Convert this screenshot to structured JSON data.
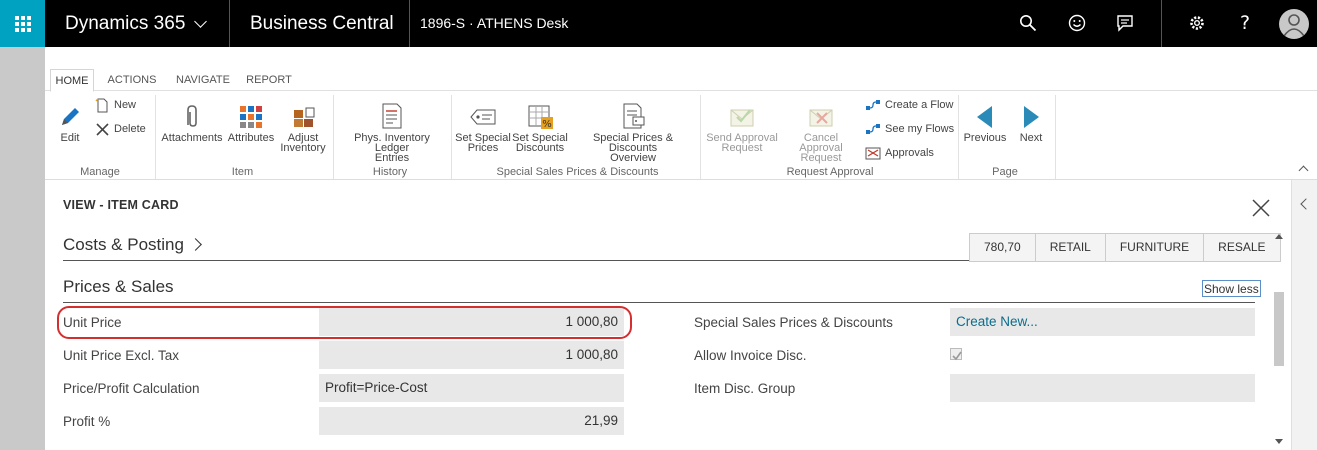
{
  "topbar": {
    "app_name": "Dynamics 365",
    "product": "Business Central",
    "company": "1896-S · ATHENS Desk"
  },
  "ribbon": {
    "tabs": [
      "HOME",
      "ACTIONS",
      "NAVIGATE",
      "REPORT"
    ],
    "manage": {
      "edit": "Edit",
      "new": "New",
      "delete": "Delete",
      "group": "Manage"
    },
    "item": {
      "attachments": "Attachments",
      "attributes": "Attributes",
      "adjust_line1": "Adjust",
      "adjust_line2": "Inventory",
      "group": "Item"
    },
    "history": {
      "line1": "Phys. Inventory Ledger",
      "line2": "Entries",
      "group": "History"
    },
    "special": {
      "set_prices_1": "Set Special",
      "set_prices_2": "Prices",
      "set_discounts_1": "Set Special",
      "set_discounts_2": "Discounts",
      "overview_1": "Special Prices & Discounts",
      "overview_2": "Overview",
      "group": "Special Sales Prices & Discounts"
    },
    "approval": {
      "send_1": "Send Approval",
      "send_2": "Request",
      "cancel_1": "Cancel Approval",
      "cancel_2": "Request",
      "create_flow": "Create a Flow",
      "see_flows": "See my Flows",
      "approvals": "Approvals",
      "group": "Request Approval"
    },
    "page": {
      "previous": "Previous",
      "next": "Next",
      "group": "Page"
    }
  },
  "card": {
    "view_title": "VIEW - ITEM CARD",
    "costs_section": "Costs & Posting",
    "facts": [
      "780,70",
      "RETAIL",
      "FURNITURE",
      "RESALE"
    ],
    "prices_section": "Prices & Sales",
    "show_less": "Show less",
    "fields_left": [
      {
        "label": "Unit Price",
        "value": "1 000,80"
      },
      {
        "label": "Unit Price Excl. Tax",
        "value": "1 000,80"
      },
      {
        "label": "Price/Profit Calculation",
        "value": "Profit=Price-Cost"
      },
      {
        "label": "Profit %",
        "value": "21,99"
      }
    ],
    "fields_right": [
      {
        "label": "Special Sales Prices & Discounts",
        "value": "Create New..."
      },
      {
        "label": "Allow Invoice Disc.",
        "value": ""
      },
      {
        "label": "Item Disc. Group",
        "value": ""
      }
    ],
    "allow_invoice_disc_checked": true
  }
}
